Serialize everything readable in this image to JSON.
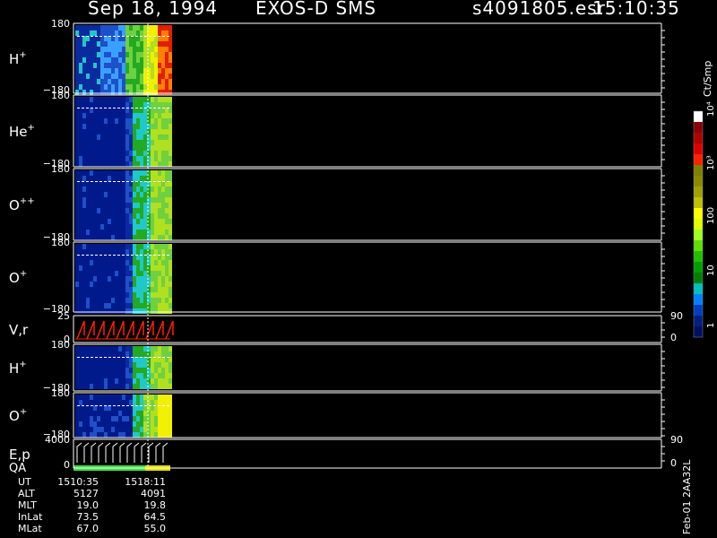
{
  "header": {
    "date": "Sep 18, 1994",
    "instrument": "EXOS-D SMS",
    "file": "s4091805.esr",
    "time": "15:10:35"
  },
  "colorbar": {
    "unit": "Ct/Smp",
    "labels": [
      "10⁴",
      "10³",
      "100",
      "10",
      "1"
    ],
    "colors": [
      "#ffffff",
      "#8b0000",
      "#b00000",
      "#e00000",
      "#ff2000",
      "#808000",
      "#8a8a00",
      "#a0a000",
      "#c0c000",
      "#ffff00",
      "#e0ff00",
      "#a0ff20",
      "#60e000",
      "#20c000",
      "#00a000",
      "#008000",
      "#00c0c0",
      "#0080ff",
      "#0040c0",
      "#002080",
      "#001060"
    ]
  },
  "panels": [
    {
      "label": "H",
      "sup": "+",
      "top_tick": "180",
      "bottom_tick": "−180"
    },
    {
      "label": "He",
      "sup": "+",
      "top_tick": "180",
      "bottom_tick": "−180"
    },
    {
      "label": "O",
      "sup": "++",
      "top_tick": "180",
      "bottom_tick": "−180"
    },
    {
      "label": "O",
      "sup": "+",
      "top_tick": "180",
      "bottom_tick": "−180"
    },
    {
      "label": "V,r",
      "sup": "",
      "top_tick": "25",
      "bottom_tick": "0",
      "right_top": "90",
      "right_bottom": "0"
    },
    {
      "label": "H",
      "sup": "+",
      "top_tick": "180",
      "bottom_tick": "−180"
    },
    {
      "label": "O",
      "sup": "+",
      "top_tick": "180",
      "bottom_tick": "−180"
    },
    {
      "label": "E,p",
      "sup": "",
      "label2": "QA",
      "top_tick": "4000",
      "bottom_tick": "0",
      "right_top": "90",
      "right_bottom": "0"
    }
  ],
  "table": {
    "rows": [
      {
        "name": "UT",
        "v1": "1510:35",
        "v2": "1518:11"
      },
      {
        "name": "ALT",
        "v1": "5127",
        "v2": "4091"
      },
      {
        "name": "MLT",
        "v1": "19.0",
        "v2": "19.8"
      },
      {
        "name": "InLat",
        "v1": "73.5",
        "v2": "64.5"
      },
      {
        "name": "MLat",
        "v1": "67.0",
        "v2": "55.0"
      }
    ]
  },
  "footer_vertical": "Feb-01 2AA32L",
  "chart_data": {
    "type": "heatmap",
    "title": "Sep 18, 1994   EXOS-D SMS",
    "colorscale_unit": "Ct/Smp",
    "colorscale_range": [
      1,
      10000
    ],
    "log_scale": true,
    "x_range_ut": [
      "1510:35",
      "1518:11"
    ],
    "panels": [
      {
        "name": "H+",
        "y_range": [
          -180,
          180
        ]
      },
      {
        "name": "He+",
        "y_range": [
          -180,
          180
        ]
      },
      {
        "name": "O++",
        "y_range": [
          -180,
          180
        ]
      },
      {
        "name": "O+",
        "y_range": [
          -180,
          180
        ]
      },
      {
        "name": "V,r",
        "y_range": [
          0,
          25
        ]
      },
      {
        "name": "H+",
        "y_range": [
          -180,
          180
        ]
      },
      {
        "name": "O+",
        "y_range": [
          -180,
          180
        ]
      },
      {
        "name": "E,p / QA",
        "y_range": [
          0,
          4000
        ]
      }
    ]
  }
}
